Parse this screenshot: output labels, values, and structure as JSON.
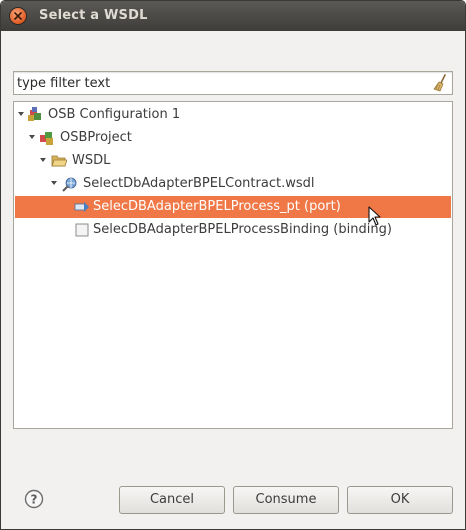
{
  "window": {
    "title": "Select a WSDL"
  },
  "filter": {
    "placeholder": "type filter text",
    "value": "",
    "clear_icon": "broom-icon"
  },
  "tree": {
    "items": [
      {
        "label": "OSB Configuration 1",
        "level": 0,
        "expanded": true,
        "icon": "osb-configuration-icon",
        "selected": false
      },
      {
        "label": "OSBProject",
        "level": 1,
        "expanded": true,
        "icon": "project-icon",
        "selected": false
      },
      {
        "label": "WSDL",
        "level": 2,
        "expanded": true,
        "icon": "folder-open-icon",
        "selected": false
      },
      {
        "label": "SelectDbAdapterBPELContract.wsdl",
        "level": 3,
        "expanded": true,
        "icon": "wsdl-file-icon",
        "selected": false
      },
      {
        "label": "SelecDBAdapterBPELProcess_pt (port)",
        "level": 4,
        "expanded": false,
        "icon": "port-icon",
        "selected": true
      },
      {
        "label": "SelecDBAdapterBPELProcessBinding (binding)",
        "level": 4,
        "expanded": false,
        "icon": "binding-icon",
        "selected": false
      }
    ]
  },
  "buttons": {
    "cancel": "Cancel",
    "consume": "Consume",
    "ok": "OK"
  },
  "colors": {
    "selection": "#f07746",
    "titlebar": "#3e3d39",
    "dialog_bg": "#f2f1f0"
  }
}
